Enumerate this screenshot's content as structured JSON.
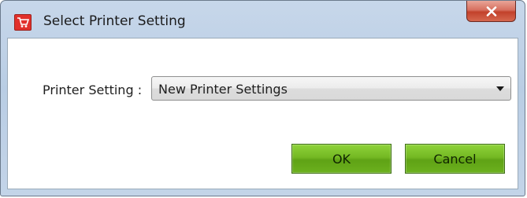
{
  "window": {
    "title": "Select Printer Setting",
    "close_symbol": "x"
  },
  "form": {
    "printer_setting_label": "Printer Setting :",
    "printer_setting_value": "New Printer Settings"
  },
  "buttons": {
    "ok_label": "OK",
    "cancel_label": "Cancel"
  },
  "icons": {
    "app": "shopping-cart-icon",
    "close": "close-icon",
    "dropdown": "chevron-down-icon"
  },
  "colors": {
    "titlebar": "#c3d4e8",
    "close_button": "#c2412b",
    "action_buttons": "#74b823",
    "app_icon": "#e1302b"
  }
}
